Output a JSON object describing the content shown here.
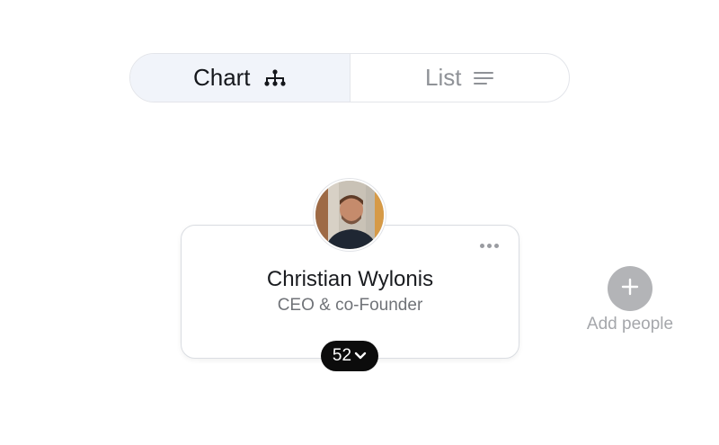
{
  "view_toggle": {
    "chart_label": "Chart",
    "chart_icon": "org-chart-icon",
    "list_label": "List",
    "list_icon": "list-lines-icon",
    "active": "Chart"
  },
  "person_card": {
    "name": "Christian Wylonis",
    "role": "CEO & co-Founder",
    "avatar": "profile-photo",
    "menu_icon": "more-horizontal-icon",
    "report_count": "52",
    "expand_icon": "chevron-down-icon"
  },
  "add_people": {
    "label": "Add people",
    "icon": "plus-icon"
  },
  "colors": {
    "active_segment_bg": "#f1f4fa",
    "pill_bg": "#0c0c0c",
    "add_button_bg": "#b3b4b7",
    "muted_text": "#8f9297"
  }
}
